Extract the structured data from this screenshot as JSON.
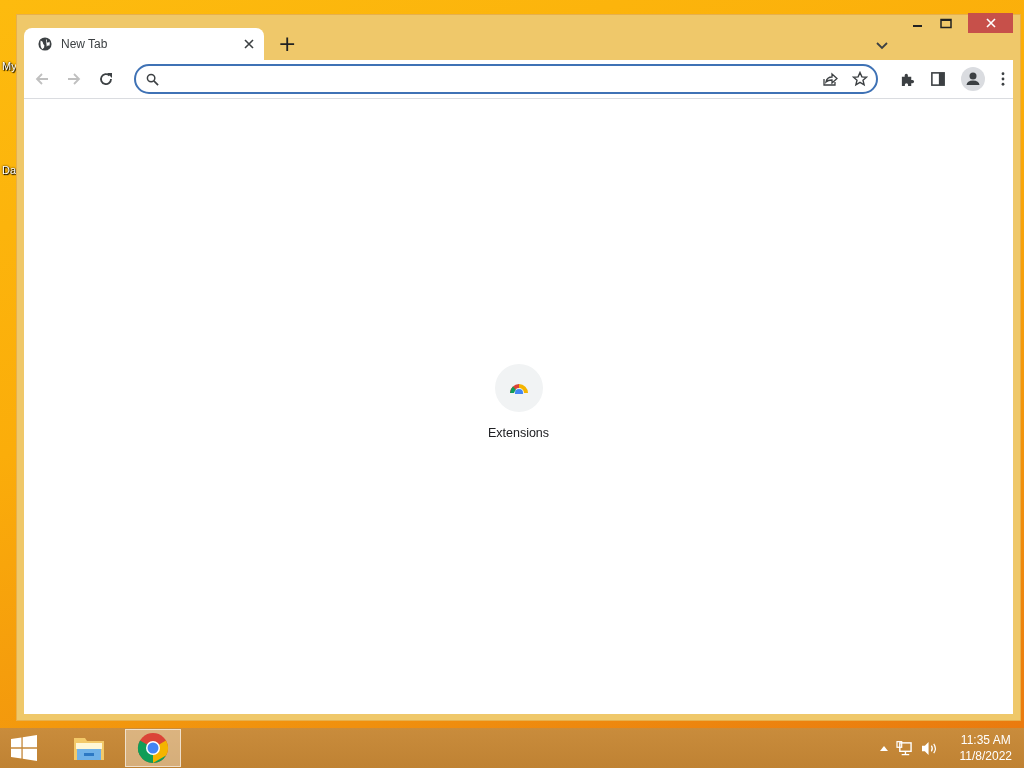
{
  "desktop": {
    "icon_labels": [
      "My",
      "Da"
    ]
  },
  "browser": {
    "tabs": [
      {
        "title": "New Tab",
        "selected": true
      }
    ],
    "new_tab_button": "+",
    "shortcuts": [
      {
        "label": "Extensions"
      }
    ]
  },
  "taskbar": {
    "apps": [
      {
        "kind": "explorer",
        "selected": false
      },
      {
        "kind": "chrome",
        "selected": true
      }
    ],
    "clock": {
      "time": "11:35 AM",
      "date": "11/8/2022"
    }
  }
}
